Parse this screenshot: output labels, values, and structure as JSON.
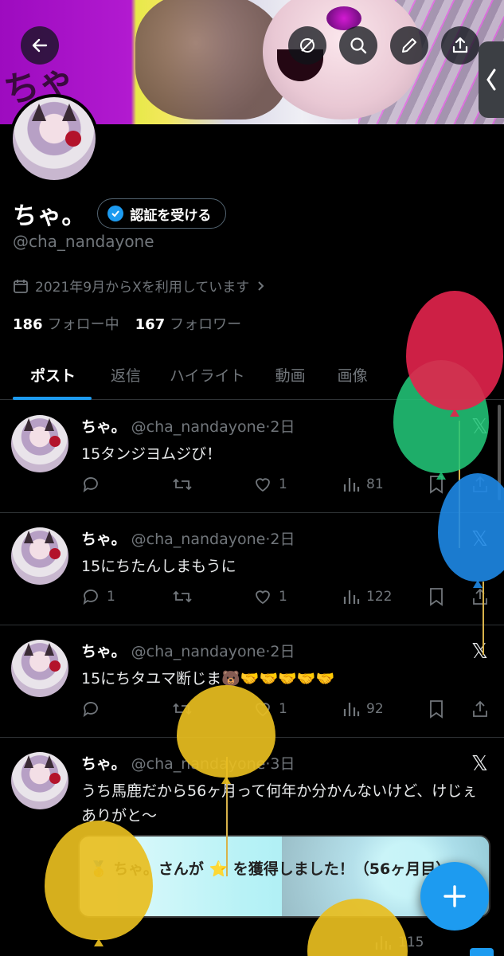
{
  "profile": {
    "name": "ちゃ。",
    "verify_label": "認証を受ける",
    "handle": "@cha_nandayone",
    "joined": "2021年9月からXを利用しています",
    "following_count": "186",
    "following_label": "フォロー中",
    "followers_count": "167",
    "followers_label": "フォロワー"
  },
  "tabs": [
    {
      "label": "ポスト"
    },
    {
      "label": "返信"
    },
    {
      "label": "ハイライト"
    },
    {
      "label": "動画"
    },
    {
      "label": "画像"
    }
  ],
  "posts": [
    {
      "name": "ちゃ。",
      "handle": "@cha_nandayone",
      "time": "·2日",
      "text": "15タンジヨムジび！",
      "reply": "",
      "like": "1",
      "views": "81"
    },
    {
      "name": "ちゃ。",
      "handle": "@cha_nandayone",
      "time": "·2日",
      "text": "15にちたんしまもうに",
      "reply": "1",
      "like": "1",
      "views": "122"
    },
    {
      "name": "ちゃ。",
      "handle": "@cha_nandayone",
      "time": "·2日",
      "text": "15にちタユマ断じま🐻🤝🤝🤝🤝🤝",
      "reply": "",
      "like": "1",
      "views": "92"
    },
    {
      "name": "ちゃ。",
      "handle": "@cha_nandayone",
      "time": "·3日",
      "text": "うち馬鹿だから56ヶ月って何年か分かんないけど、けじぇありがと〜",
      "reply": "",
      "like": "",
      "views": "115"
    }
  ],
  "toast": {
    "text": "🥇 ちゃ。さんが ⭐ を獲得しました！（56ヶ月目）"
  },
  "x_logo": "𝕏",
  "icons": {
    "back": "back-arrow-icon",
    "hide": "eye-slash-icon",
    "search": "search-icon",
    "edit": "pencil-icon",
    "share": "share-icon"
  },
  "colors": {
    "accent": "#1d9bf0",
    "muted": "#71767b",
    "background": "#000000"
  }
}
